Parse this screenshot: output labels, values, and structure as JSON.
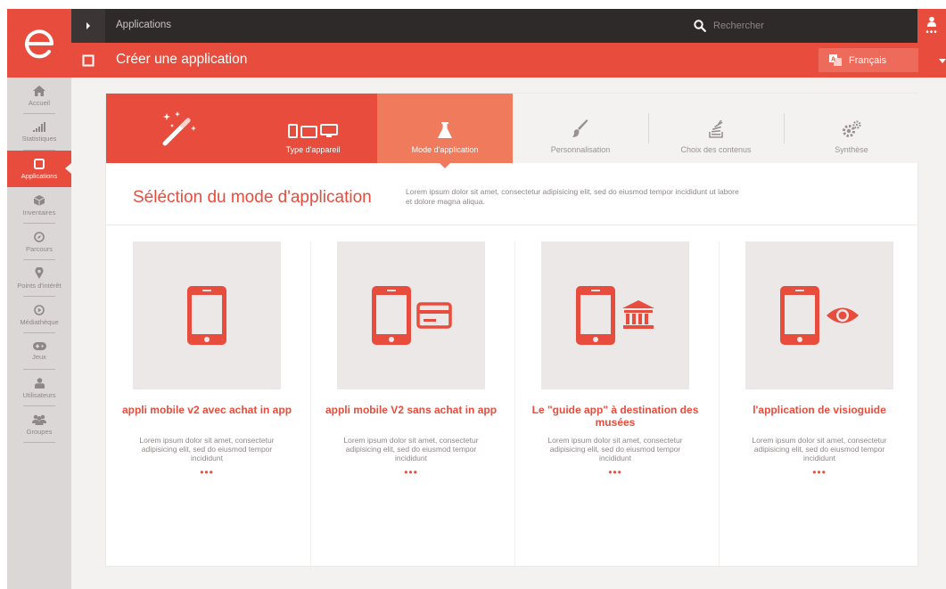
{
  "topbar": {
    "title": "Applications",
    "search_placeholder": "Rechercher",
    "user_more": "•••"
  },
  "header": {
    "page_title": "Créer une application",
    "language": "Français"
  },
  "sidebar": {
    "items": [
      {
        "label": "Accueil",
        "icon": "home-icon"
      },
      {
        "label": "Statistiques",
        "icon": "stats-icon"
      },
      {
        "label": "Applications",
        "icon": "applications-icon",
        "active": true
      },
      {
        "label": "Inventaires",
        "icon": "cube-icon"
      },
      {
        "label": "Parcours",
        "icon": "compass-icon"
      },
      {
        "label": "Points d'intérêt",
        "icon": "map-pin-icon"
      },
      {
        "label": "Médiathèque",
        "icon": "play-icon"
      },
      {
        "label": "Jeux",
        "icon": "gamepad-icon"
      },
      {
        "label": "Utilisateurs",
        "icon": "user-icon"
      },
      {
        "label": "Groupes",
        "icon": "group-icon"
      }
    ]
  },
  "steps": {
    "device": "Type d'appareil",
    "mode": "Mode d'application",
    "personalisation": "Personnalisation",
    "content": "Choix des contenus",
    "summary": "Synthèse"
  },
  "section": {
    "title": "Séléction du mode d'application",
    "description": "Lorem ipsum dolor sit amet, consectetur adipisicing elit, sed do eiusmod tempor incididunt ut labore et dolore magna aliqua."
  },
  "cards": [
    {
      "title": "appli mobile v2 avec achat in app",
      "desc": "Lorem ipsum dolor sit amet, consectetur adipisicing elit, sed do eiusmod tempor incididunt",
      "more": "•••",
      "icon": "phone-icon"
    },
    {
      "title": "appli mobile V2 sans achat in app",
      "desc": "Lorem ipsum dolor sit amet, consectetur adipisicing elit, sed do eiusmod tempor incididunt",
      "more": "•••",
      "icon": "phone-card-icon"
    },
    {
      "title": "Le \"guide app\"  à destination des musées",
      "desc": "Lorem ipsum dolor sit amet, consectetur adipisicing elit, sed do eiusmod tempor incididunt",
      "more": "•••",
      "icon": "phone-museum-icon"
    },
    {
      "title": "l'application de visioguide",
      "desc": "Lorem ipsum dolor sit amet, consectetur adipisicing elit, sed do eiusmod tempor incididunt",
      "more": "•••",
      "icon": "phone-eye-icon"
    }
  ],
  "colors": {
    "accent": "#e74c3c",
    "accent_light": "#f07a5c",
    "dark": "#2f2a2a",
    "muted": "#8e8787"
  }
}
